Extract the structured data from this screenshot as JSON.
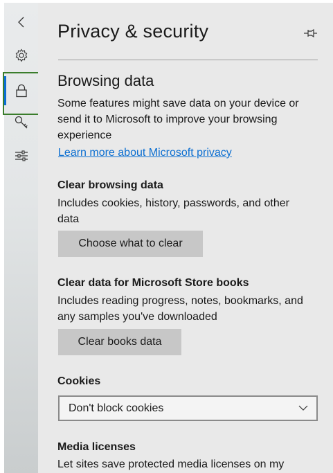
{
  "rail": {
    "items": [
      {
        "name": "back",
        "icon": "chevron-left-icon"
      },
      {
        "name": "settings",
        "icon": "gear-icon"
      },
      {
        "name": "privacy-security",
        "icon": "lock-icon",
        "active": true
      },
      {
        "name": "passwords",
        "icon": "key-icon"
      },
      {
        "name": "advanced",
        "icon": "sliders-icon"
      }
    ],
    "active_color": "#0a6ed1",
    "highlight_color": "#3a7d2c"
  },
  "header": {
    "title": "Privacy & security",
    "pin_icon": "pin-icon"
  },
  "browsing_data": {
    "heading": "Browsing data",
    "description_line1": "Some features might save data on your device or",
    "description_line2": "send it to Microsoft to improve your browsing",
    "description_line3": "experience",
    "link": "Learn more about Microsoft privacy"
  },
  "clear_browsing": {
    "heading": "Clear browsing data",
    "description_line1": "Includes cookies, history, passwords, and other",
    "description_line2": "data",
    "button": "Choose what to clear"
  },
  "clear_books": {
    "heading": "Clear data for Microsoft Store books",
    "description_line1": "Includes reading progress, notes, bookmarks, and",
    "description_line2": "any samples you've downloaded",
    "button": "Clear books data"
  },
  "cookies": {
    "heading": "Cookies",
    "selected": "Don't block cookies"
  },
  "media_licenses": {
    "heading": "Media licenses",
    "description_line1": "Let sites save protected media licenses on my"
  }
}
